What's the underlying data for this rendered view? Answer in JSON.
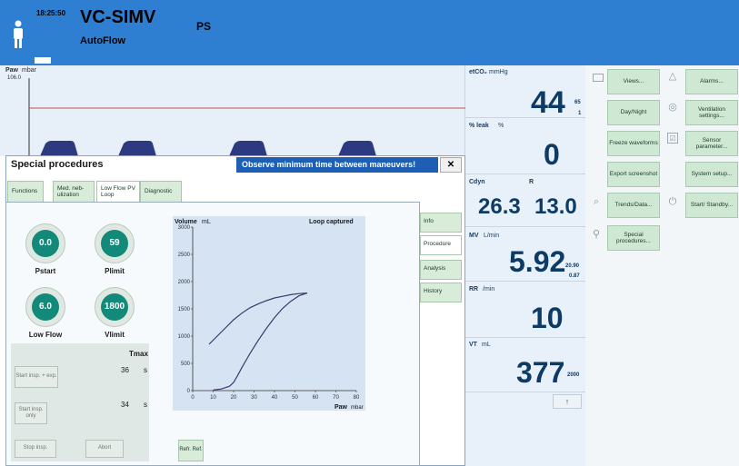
{
  "header": {
    "time": "18:25:50",
    "mode": "VC-SIMV",
    "submode": "AutoFlow",
    "ps": "PS"
  },
  "waveform": {
    "label": "Paw",
    "unit": "mbar",
    "max": "106.0"
  },
  "params": {
    "etco2": {
      "label": "etCO₂",
      "unit": "mmHg",
      "value": "44",
      "hi": "65",
      "lo": "1"
    },
    "leak": {
      "label": "% leak",
      "unit": "%",
      "value": "0"
    },
    "cdyn": {
      "label": "Cdyn",
      "value": "26.3"
    },
    "r": {
      "label": "R",
      "value": "13.0"
    },
    "mv": {
      "label": "MV",
      "unit": "L/min",
      "value": "5.92",
      "hi": "20.90",
      "lo": "0.87"
    },
    "rr": {
      "label": "RR",
      "unit": "/min",
      "value": "10"
    },
    "vt": {
      "label": "VT",
      "unit": "mL",
      "value": "377",
      "hi": "2000"
    },
    "scroll_up": "↑"
  },
  "right_panel": {
    "views": "Views...",
    "alarms": "Alarms...",
    "daynight": "Day/Night",
    "vent_settings": "Ventilation settings...",
    "freeze": "Freeze waveforms",
    "sensor": "Sensor parameter...",
    "export": "Export screenshot",
    "system": "System setup...",
    "trends": "Trends/Data...",
    "start": "Start/ Standby...",
    "special": "Special procedures..."
  },
  "dialog": {
    "title": "Special procedures",
    "message": "Observe minimum time between maneuvers!",
    "close": "✕",
    "tabs": [
      "Functions",
      "Med. neb-ulization",
      "Low Flow PV Loop",
      "Diagnostic"
    ],
    "side_tabs": [
      "Info",
      "Procedure",
      "Analysis",
      "History"
    ],
    "knobs": [
      {
        "value": "0.0",
        "label": "Pstart"
      },
      {
        "value": "59",
        "label": "Plimit"
      },
      {
        "value": "6.0",
        "label": "Low Flow"
      },
      {
        "value": "1800",
        "label": "Vlimit"
      }
    ],
    "tmax_label": "Tmax",
    "tmax1": "36",
    "tmax2": "34",
    "unit_s": "s",
    "btn_start_insp_exp": "Start insp. + exp.",
    "btn_start_insp_only": "Start insp. only",
    "btn_stop_insp": "Stop insp.",
    "btn_abort": "Abort",
    "btn_refr_ref": "Refr. Ref."
  },
  "chart_data": {
    "type": "line",
    "title": "Loop captured",
    "ylabel": "Volume",
    "yunit": "mL",
    "xlabel": "Paw",
    "xunit": "mbar",
    "xlim": [
      0,
      80
    ],
    "ylim": [
      0,
      3000
    ],
    "xticks": [
      0,
      10,
      20,
      30,
      40,
      50,
      60,
      70,
      80
    ],
    "yticks": [
      0,
      500,
      1000,
      1500,
      2000,
      2500,
      3000
    ],
    "series": [
      {
        "x": [
          8,
          12,
          16,
          20,
          24,
          28,
          32,
          36,
          40,
          44,
          48,
          52,
          56
        ],
        "y": [
          850,
          1000,
          1150,
          1300,
          1420,
          1520,
          1590,
          1650,
          1700,
          1730,
          1760,
          1780,
          1790
        ]
      },
      {
        "x": [
          10,
          14,
          18,
          20,
          22,
          24,
          26,
          28,
          32,
          36,
          40,
          44,
          48,
          52,
          56
        ],
        "y": [
          10,
          30,
          80,
          150,
          280,
          420,
          550,
          680,
          920,
          1140,
          1340,
          1510,
          1640,
          1740,
          1790
        ]
      }
    ],
    "colors": {
      "line": "#3a3a6e",
      "plot_bg": "#d5e3f2"
    }
  }
}
